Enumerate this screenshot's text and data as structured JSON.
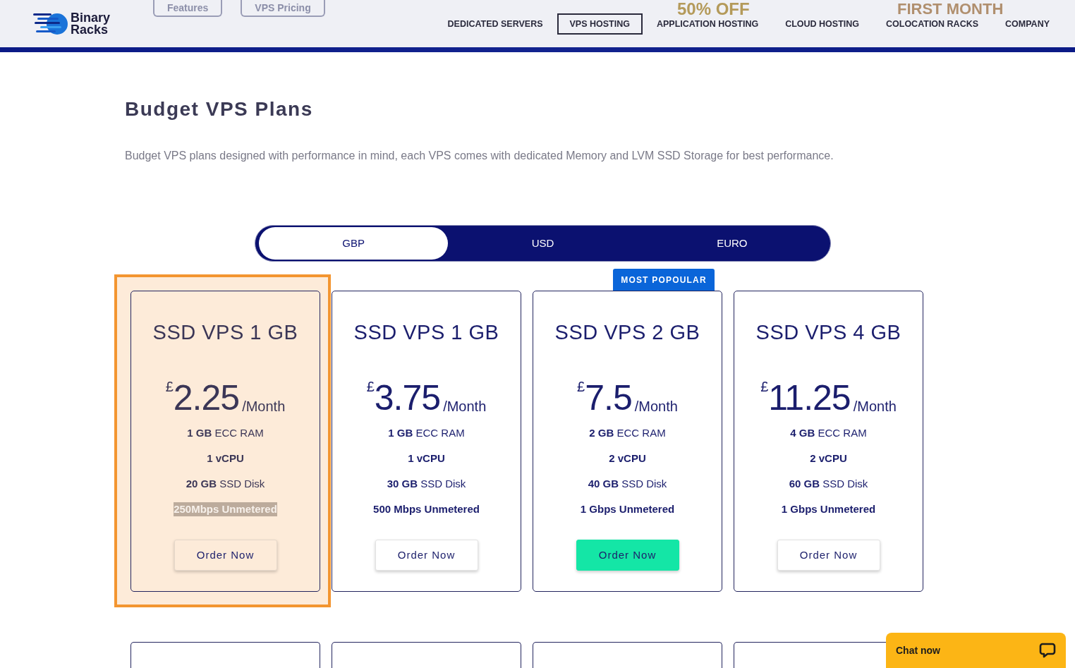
{
  "header": {
    "logo": {
      "line_1": "Binary",
      "line_2": "Racks"
    },
    "hero_buttons": [
      "Features",
      "VPS Pricing"
    ],
    "hero_offer": "50% OFF",
    "hero_period": "FIRST MONTH",
    "nav": [
      {
        "label": "DEDICATED SERVERS",
        "selected": false
      },
      {
        "label": "VPS HOSTING",
        "selected": true
      },
      {
        "label": "APPLICATION HOSTING",
        "selected": false
      },
      {
        "label": "CLOUD HOSTING",
        "selected": false
      },
      {
        "label": "COLOCATION RACKS",
        "selected": false
      },
      {
        "label": "COMPANY",
        "selected": false
      }
    ]
  },
  "section": {
    "title": "Budget VPS Plans",
    "description": "Budget VPS plans designed with performance in mind, each VPS comes with dedicated Memory and LVM SSD Storage for best performance."
  },
  "currency_tabs": [
    {
      "label": "GBP",
      "selected": true
    },
    {
      "label": "USD",
      "selected": false
    },
    {
      "label": "EURO",
      "selected": false
    }
  ],
  "plans": [
    {
      "name": "SSD VPS 1 GB",
      "currency": "£",
      "price": "2.25",
      "period": "/Month",
      "highlighted": true,
      "popular": false,
      "features": [
        {
          "text": "**1 GB** ECC RAM",
          "bold": false,
          "highlighted": false
        },
        {
          "text": "1 vCPU",
          "bold": true,
          "highlighted": false
        },
        {
          "text": "**20 GB** SSD Disk",
          "bold": false,
          "highlighted": false
        },
        {
          "text": "250Mbps Unmetered",
          "bold": true,
          "highlighted": true
        }
      ],
      "button": "Order Now"
    },
    {
      "name": "SSD VPS 1 GB",
      "currency": "£",
      "price": "3.75",
      "period": "/Month",
      "highlighted": false,
      "popular": false,
      "features": [
        {
          "text": "**1 GB** ECC RAM",
          "bold": false,
          "highlighted": false
        },
        {
          "text": "1 vCPU",
          "bold": true,
          "highlighted": false
        },
        {
          "text": "**30 GB** SSD Disk",
          "bold": false,
          "highlighted": false
        },
        {
          "text": "500 Mbps Unmetered",
          "bold": true,
          "highlighted": false
        }
      ],
      "button": "Order Now"
    },
    {
      "name": "SSD VPS 2 GB",
      "currency": "£",
      "price": "7.5",
      "period": "/Month",
      "highlighted": false,
      "popular": true,
      "badge": "MOST POPOULAR",
      "features": [
        {
          "text": "**2 GB** ECC RAM",
          "bold": false,
          "highlighted": false
        },
        {
          "text": "2 vCPU",
          "bold": true,
          "highlighted": false
        },
        {
          "text": "**40 GB** SSD Disk",
          "bold": false,
          "highlighted": false
        },
        {
          "text": "1 Gbps Unmetered",
          "bold": true,
          "highlighted": false
        }
      ],
      "button": "Order Now"
    },
    {
      "name": "SSD VPS 4 GB",
      "currency": "£",
      "price": "11.25",
      "period": "/Month",
      "highlighted": false,
      "popular": false,
      "features": [
        {
          "text": "**4 GB** ECC RAM",
          "bold": false,
          "highlighted": false
        },
        {
          "text": "2 vCPU",
          "bold": true,
          "highlighted": false
        },
        {
          "text": "**60 GB** SSD Disk",
          "bold": false,
          "highlighted": false
        },
        {
          "text": "1 Gbps Unmetered",
          "bold": true,
          "highlighted": false
        }
      ],
      "button": "Order Now"
    }
  ],
  "more_plans": [
    {
      "kind": "card"
    },
    {
      "kind": "card"
    },
    {
      "kind": "card"
    },
    {
      "kind": "card"
    }
  ],
  "chat": {
    "label": "Chat now"
  }
}
